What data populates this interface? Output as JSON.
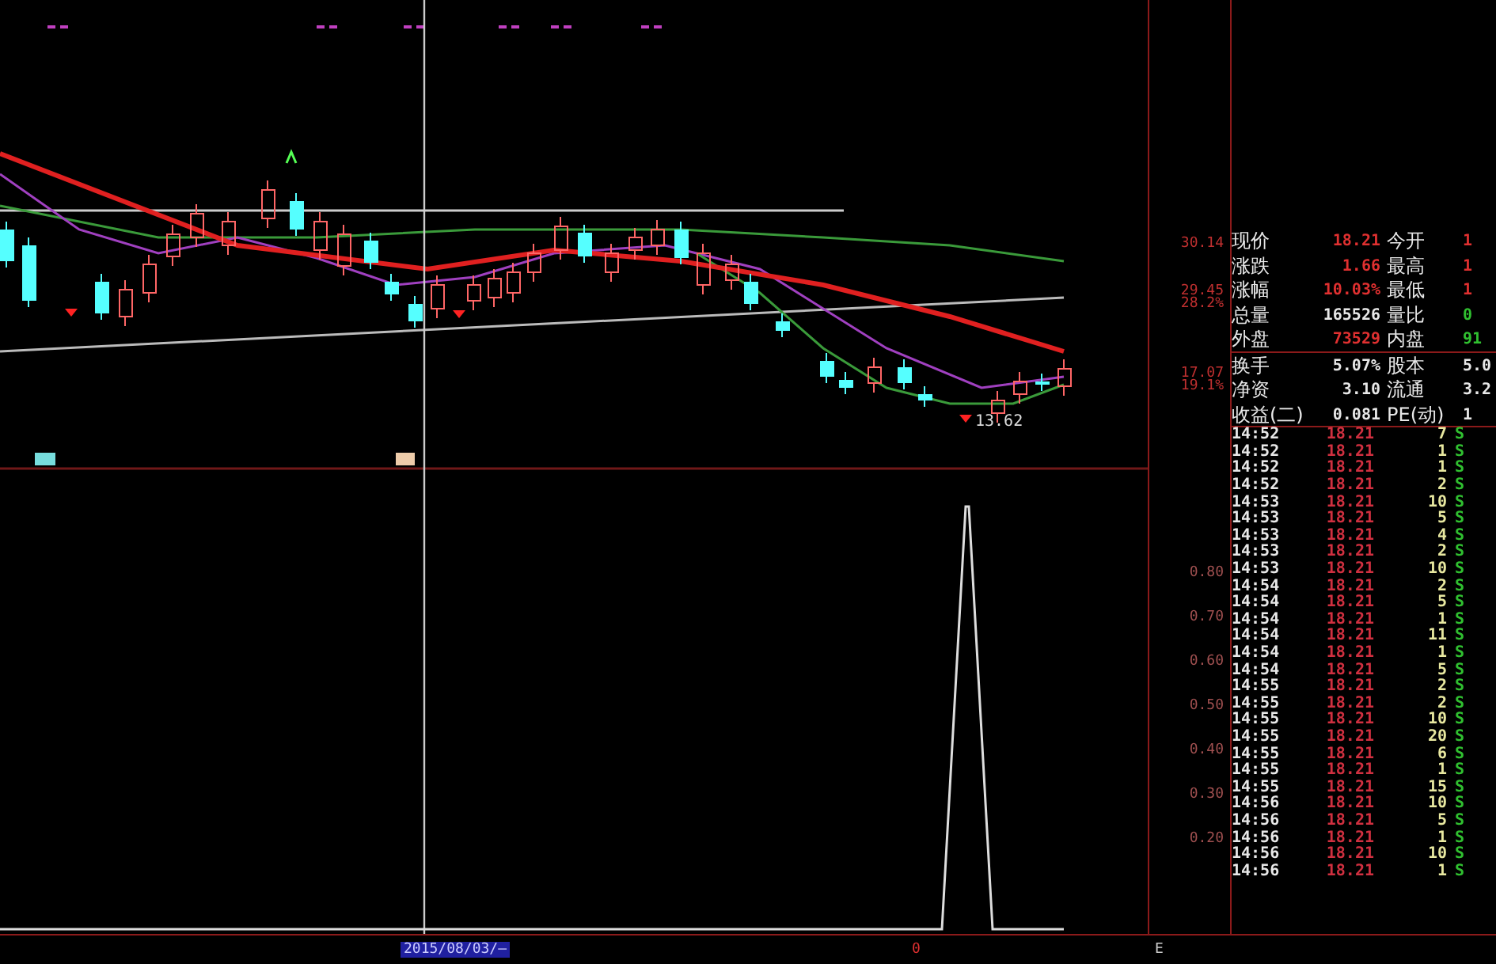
{
  "price_axis": [
    {
      "price": "30.14"
    },
    {
      "price": "29.45",
      "change": "28.2%"
    },
    {
      "price": "17.07",
      "change": "19.1%"
    }
  ],
  "indicator_axis": [
    "0.80",
    "0.70",
    "0.60",
    "0.50",
    "0.40",
    "0.30",
    "0.20"
  ],
  "chart": {
    "low_marker": "13.62"
  },
  "quote": [
    {
      "label": "现价",
      "value": "18.21",
      "color": "#e03030"
    },
    {
      "label": "今开",
      "value": "1",
      "color": "#e03030"
    },
    {
      "label": "涨跌",
      "value": "1.66",
      "color": "#e03030"
    },
    {
      "label": "最高",
      "value": "1",
      "color": "#e03030"
    },
    {
      "label": "涨幅",
      "value": "10.03%",
      "color": "#e03030"
    },
    {
      "label": "最低",
      "value": "1",
      "color": "#e03030"
    },
    {
      "label": "总量",
      "value": "165526",
      "color": "#e8e8e8"
    },
    {
      "label": "量比",
      "value": "0",
      "color": "#30c030"
    },
    {
      "label": "外盘",
      "value": "73529",
      "color": "#e03030"
    },
    {
      "label": "内盘",
      "value": "91",
      "color": "#30c030"
    },
    {
      "label": "换手",
      "value": "5.07%",
      "color": "#e8e8e8"
    },
    {
      "label": "股本",
      "value": "5.0",
      "color": "#e8e8e8"
    },
    {
      "label": "净资",
      "value": "3.10",
      "color": "#e8e8e8"
    },
    {
      "label": "流通",
      "value": "3.2",
      "color": "#e8e8e8"
    },
    {
      "label": "收益(二)",
      "value": "0.081",
      "color": "#e8e8e8"
    },
    {
      "label": "PE(动)",
      "value": "1",
      "color": "#e8e8e8"
    }
  ],
  "ticks": [
    {
      "time": "14:52",
      "price": "18.21",
      "volume": "7",
      "side": "S"
    },
    {
      "time": "14:52",
      "price": "18.21",
      "volume": "1",
      "side": "S"
    },
    {
      "time": "14:52",
      "price": "18.21",
      "volume": "1",
      "side": "S"
    },
    {
      "time": "14:52",
      "price": "18.21",
      "volume": "2",
      "side": "S"
    },
    {
      "time": "14:53",
      "price": "18.21",
      "volume": "10",
      "side": "S"
    },
    {
      "time": "14:53",
      "price": "18.21",
      "volume": "5",
      "side": "S"
    },
    {
      "time": "14:53",
      "price": "18.21",
      "volume": "4",
      "side": "S"
    },
    {
      "time": "14:53",
      "price": "18.21",
      "volume": "2",
      "side": "S"
    },
    {
      "time": "14:53",
      "price": "18.21",
      "volume": "10",
      "side": "S"
    },
    {
      "time": "14:54",
      "price": "18.21",
      "volume": "2",
      "side": "S"
    },
    {
      "time": "14:54",
      "price": "18.21",
      "volume": "5",
      "side": "S"
    },
    {
      "time": "14:54",
      "price": "18.21",
      "volume": "1",
      "side": "S"
    },
    {
      "time": "14:54",
      "price": "18.21",
      "volume": "11",
      "side": "S"
    },
    {
      "time": "14:54",
      "price": "18.21",
      "volume": "1",
      "side": "S"
    },
    {
      "time": "14:54",
      "price": "18.21",
      "volume": "5",
      "side": "S"
    },
    {
      "time": "14:55",
      "price": "18.21",
      "volume": "2",
      "side": "S"
    },
    {
      "time": "14:55",
      "price": "18.21",
      "volume": "2",
      "side": "S"
    },
    {
      "time": "14:55",
      "price": "18.21",
      "volume": "10",
      "side": "S"
    },
    {
      "time": "14:55",
      "price": "18.21",
      "volume": "20",
      "side": "S"
    },
    {
      "time": "14:55",
      "price": "18.21",
      "volume": "6",
      "side": "S"
    },
    {
      "time": "14:55",
      "price": "18.21",
      "volume": "1",
      "side": "S"
    },
    {
      "time": "14:55",
      "price": "18.21",
      "volume": "15",
      "side": "S"
    },
    {
      "time": "14:56",
      "price": "18.21",
      "volume": "10",
      "side": "S"
    },
    {
      "time": "14:56",
      "price": "18.21",
      "volume": "5",
      "side": "S"
    },
    {
      "time": "14:56",
      "price": "18.21",
      "volume": "1",
      "side": "S"
    },
    {
      "time": "14:56",
      "price": "18.21",
      "volume": "10",
      "side": "S"
    },
    {
      "time": "14:56",
      "price": "18.21",
      "volume": "1",
      "side": "S"
    }
  ],
  "status_bar": {
    "date": "2015/08/03/—",
    "cursor_value": "0",
    "corner": "E"
  }
}
